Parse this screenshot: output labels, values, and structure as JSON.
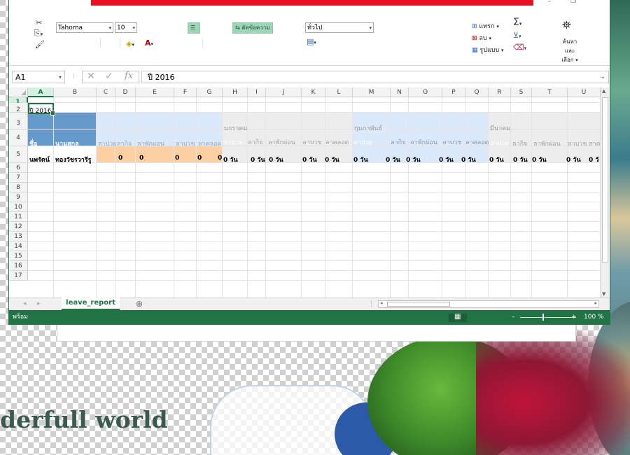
{
  "desktop": {
    "tagline": "derfull world"
  },
  "ribbon": {
    "font_name": "Tahoma",
    "font_size": "10",
    "wrap_text_label": "ตัดข้อความ",
    "number_format": "ทั่วไป",
    "insert_label": "แทรก",
    "delete_label": "ลบ",
    "format_label": "รูปแบบ",
    "find_select_label_1": "ค้นหาและ",
    "find_select_label_2": "เลือก"
  },
  "formula_bar": {
    "name_box": "A1",
    "content": "ปี 2016"
  },
  "grid": {
    "columns": [
      "A",
      "B",
      "C",
      "D",
      "E",
      "F",
      "G",
      "H",
      "I",
      "J",
      "K",
      "L",
      "M",
      "N",
      "O",
      "P",
      "Q",
      "R",
      "S",
      "T",
      "U"
    ],
    "rows": [
      "1",
      "2",
      "3",
      "4",
      "5",
      "6",
      "7",
      "8",
      "9",
      "10",
      "11",
      "12",
      "13",
      "14",
      "15",
      "16",
      "17"
    ],
    "cells": {
      "a1": "ปี 2016",
      "a3": "ชื่อ",
      "b3": "นามสกุล",
      "h2": "มกราคม",
      "m2": "กุมภาพันธ์",
      "r2": "มีนาคม",
      "leave_types": [
        "ลาป่วย",
        "ลากิจ",
        "ลาพักผ่อน",
        "ลาบวช",
        "ลาคลอด"
      ],
      "r3_labels": [
        "ลาป่วย",
        "ลากิจ",
        "ลาพักผ่อน",
        "ลาบวช",
        "ลาค"
      ],
      "a4": "นพรัตน์",
      "b4": "ทองวัชรวารีรู",
      "total_values": [
        "0",
        "0",
        "0",
        "0",
        "0"
      ],
      "month_value": "0 วัน",
      "last_partial": "0 วั"
    }
  },
  "sheet_tab": "leave_report",
  "status": {
    "ready": "พร้อม",
    "zoom": "100 %"
  },
  "colors": {
    "excel_green": "#217346",
    "header_blue": "#6699cc",
    "light_blue": "#dbe9fb",
    "orange": "#fcd0a4",
    "gray": "#ededed"
  }
}
